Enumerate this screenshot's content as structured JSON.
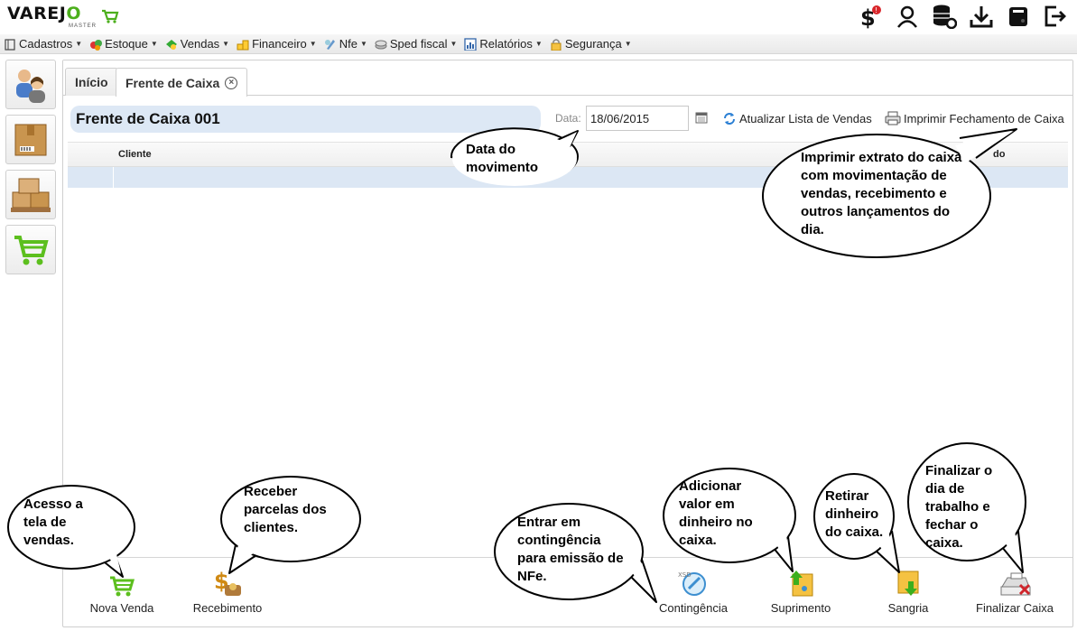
{
  "app": {
    "logo_text_a": "VAREJ",
    "logo_text_o": "O",
    "logo_sub": "MASTER"
  },
  "menu": [
    {
      "label": "Cadastros"
    },
    {
      "label": "Estoque"
    },
    {
      "label": "Vendas"
    },
    {
      "label": "Financeiro"
    },
    {
      "label": "Nfe"
    },
    {
      "label": "Sped fiscal"
    },
    {
      "label": "Relatórios"
    },
    {
      "label": "Segurança"
    }
  ],
  "tabs": [
    {
      "label": "Início"
    },
    {
      "label": "Frente de Caixa"
    }
  ],
  "main": {
    "title": "Frente de Caixa 001",
    "date_label": "Data:",
    "date_value": "18/06/2015",
    "refresh_label": "Atualizar Lista de Vendas",
    "print_label": "Imprimir Fechamento de Caixa",
    "col_cliente": "Cliente",
    "col_end": "do"
  },
  "bottom_buttons": [
    {
      "label": "Nova Venda"
    },
    {
      "label": "Recebimento"
    },
    {
      "label": "Contingência"
    },
    {
      "label": "Suprimento"
    },
    {
      "label": "Sangria"
    },
    {
      "label": "Finalizar Caixa"
    }
  ],
  "callouts": {
    "data_movimento": [
      "Data do",
      "movimento"
    ],
    "imprimir": [
      "Imprimir extrato do caixa",
      "com movimentação de",
      "vendas, recebimento e",
      "outros lançamentos do",
      "dia."
    ],
    "acesso": [
      "Acesso a",
      "tela de",
      "vendas."
    ],
    "receber": [
      "Receber",
      "parcelas dos",
      "clientes."
    ],
    "entrar": [
      "Entrar em",
      "contingência",
      "para emissão de",
      "NFe."
    ],
    "adicionar": [
      "Adicionar",
      "valor em",
      "dinheiro no",
      "caixa."
    ],
    "retirar": [
      "Retirar",
      "dinheiro",
      "do caixa."
    ],
    "finalizar": [
      "Finalizar o",
      "dia de",
      "trabalho e",
      "fechar o",
      "caixa."
    ]
  },
  "colors": {
    "accent": "#4caf1c",
    "title_bg": "#dde8f5",
    "row_bg": "#dce7f4"
  }
}
